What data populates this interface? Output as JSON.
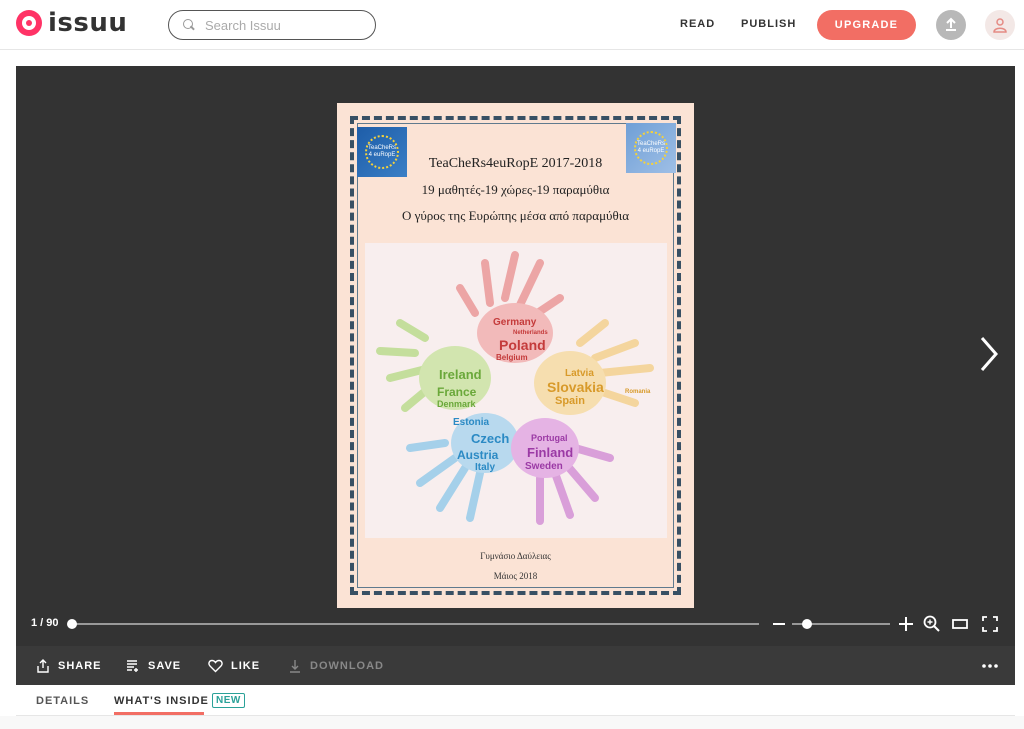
{
  "header": {
    "brand": "issuu",
    "search_placeholder": "Search Issuu",
    "read_label": "READ",
    "publish_label": "PUBLISH",
    "upgrade_label": "UPGRADE"
  },
  "document": {
    "page_title_1": "TeaCheRs4euRopE 2017-2018",
    "page_title_2": "19 μαθητές-19 χώρες-19 παραμύθια",
    "page_title_3": "Ο γύρος της Ευρώπης μέσα από παραμύθια",
    "badge_text": "TeaCheRs 4 euRopE",
    "footer_school": "Γυμνάσιο Δαύλειας",
    "footer_date": "Μάιος 2018",
    "countries": {
      "germany": "Germany",
      "poland": "Poland",
      "belgium": "Belgium",
      "netherlands": "Netherlands",
      "ireland": "Ireland",
      "france": "France",
      "denmark": "Denmark",
      "latvia": "Latvia",
      "slovakia": "Slovakia",
      "spain": "Spain",
      "romania": "Romania",
      "estonia": "Estonia",
      "czech": "Czech",
      "austria": "Austria",
      "italy": "Italy",
      "portugal": "Portugal",
      "finland": "Finland",
      "sweden": "Sweden"
    }
  },
  "viewer": {
    "page_indicator": "1 / 90",
    "progress": 0.0,
    "zoom": 0.15
  },
  "actions": {
    "share": "SHARE",
    "save": "SAVE",
    "like": "LIKE",
    "download": "DOWNLOAD"
  },
  "tabs": {
    "details": "DETAILS",
    "whats_inside": "WHAT'S INSIDE",
    "new_badge": "NEW"
  },
  "colors": {
    "brand": "#f26e64",
    "viewer_bg": "#333333",
    "accent_teal": "#2aa198"
  }
}
